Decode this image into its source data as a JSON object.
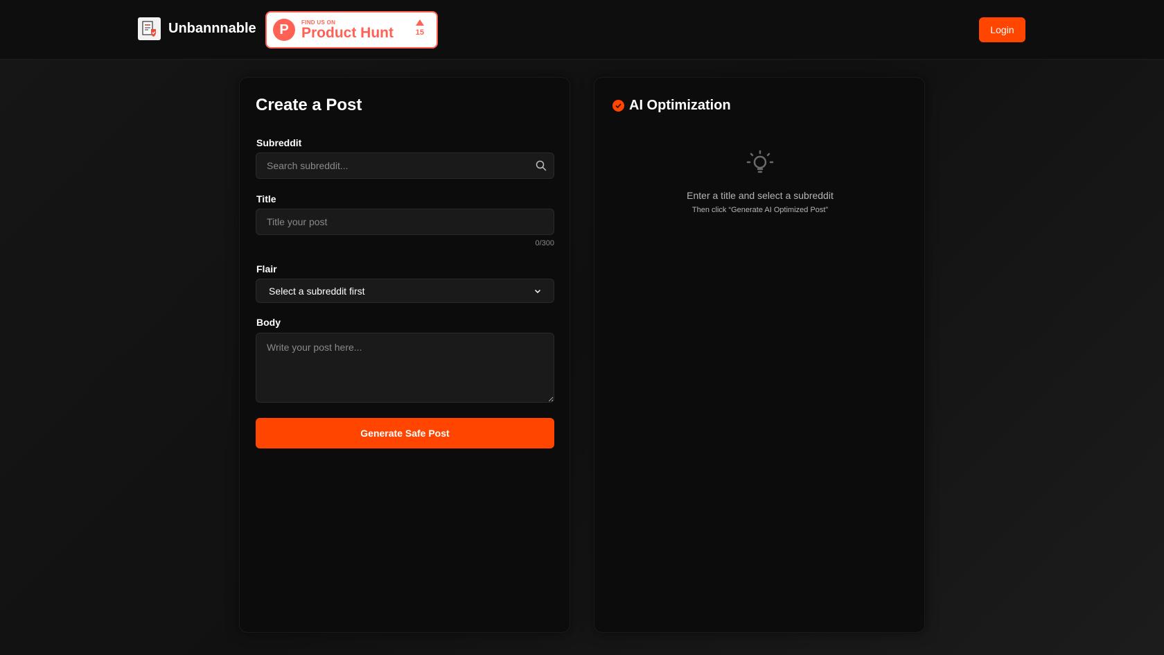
{
  "header": {
    "brand_name": "Unbannnable",
    "product_hunt": {
      "find_us": "FIND US ON",
      "name": "Product Hunt",
      "logo_letter": "P",
      "votes": "15"
    },
    "login_label": "Login"
  },
  "create_post": {
    "title": "Create a Post",
    "subreddit_label": "Subreddit",
    "subreddit_placeholder": "Search subreddit...",
    "title_label": "Title",
    "title_placeholder": "Title your post",
    "title_counter": "0/300",
    "flair_label": "Flair",
    "flair_selected": "Select a subreddit first",
    "body_label": "Body",
    "body_placeholder": "Write your post here...",
    "generate_label": "Generate Safe Post"
  },
  "ai_optimization": {
    "title": "AI Optimization",
    "hint_main": "Enter a title and select a subreddit",
    "hint_sub": "Then click “Generate AI Optimized Post”"
  },
  "colors": {
    "accent": "#ff4500",
    "product_hunt": "#ff6154",
    "background": "#111111",
    "panel": "#0c0c0c"
  },
  "icons": {
    "logo": "document-shield-icon",
    "search": "search-icon",
    "chevron": "chevron-down-icon",
    "check": "check-circle-icon",
    "bulb": "lightbulb-icon"
  }
}
